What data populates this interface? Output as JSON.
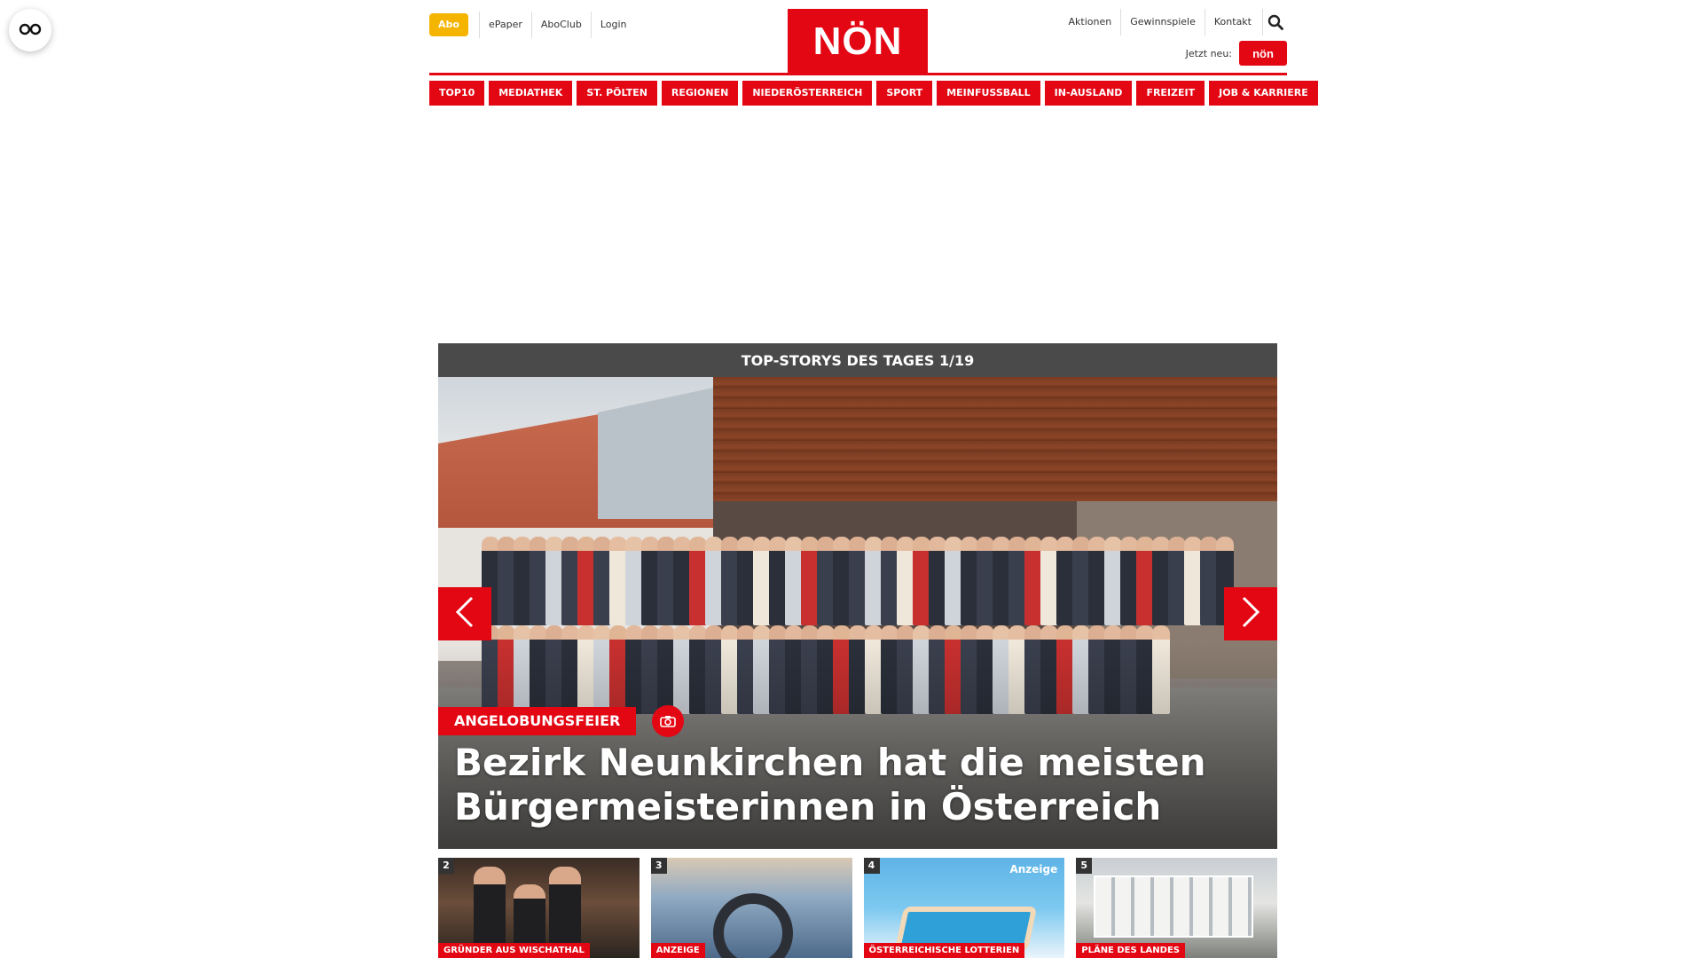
{
  "reader_button": {
    "icon": "glasses-icon"
  },
  "header": {
    "abo_label": "Abo",
    "left_links": [
      "ePaper",
      "AboClub",
      "Login"
    ],
    "logo_text": "NÖN",
    "right_links": [
      "Aktionen",
      "Gewinnspiele",
      "Kontakt"
    ],
    "search_icon": "search-icon",
    "jetzt_label": "Jetzt neu:",
    "jetzt_logo_text": "nön",
    "brand_color": "#e30613",
    "abo_color": "#f5b400"
  },
  "nav": {
    "items": [
      "TOP10",
      "MEDIATHEK",
      "ST. PÖLTEN",
      "REGIONEN",
      "NIEDERÖSTERREICH",
      "SPORT",
      "MEINFUSSBALL",
      "IN-AUSLAND",
      "FREIZEIT",
      "JOB & KARRIERE"
    ]
  },
  "slider": {
    "heading": "TOP-STORYS DES TAGES 1/19",
    "kicker": "ANGELOBUNGSFEIER",
    "camera_icon": "camera-icon",
    "headline": "Bezirk Neunkirchen hat die meisten Bürgermeisterinnen in Österreich",
    "prev_icon": "chevron-left-icon",
    "next_icon": "chevron-right-icon"
  },
  "thumbnails": [
    {
      "number": "2",
      "tag": "GRÜNDER AUS WISCHATHAL",
      "anzeige": ""
    },
    {
      "number": "3",
      "tag": "ANZEIGE",
      "anzeige": ""
    },
    {
      "number": "4",
      "tag": "ÖSTERREICHISCHE LOTTERIEN",
      "anzeige": "Anzeige"
    },
    {
      "number": "5",
      "tag": "PLÄNE DES LANDES",
      "anzeige": ""
    }
  ]
}
